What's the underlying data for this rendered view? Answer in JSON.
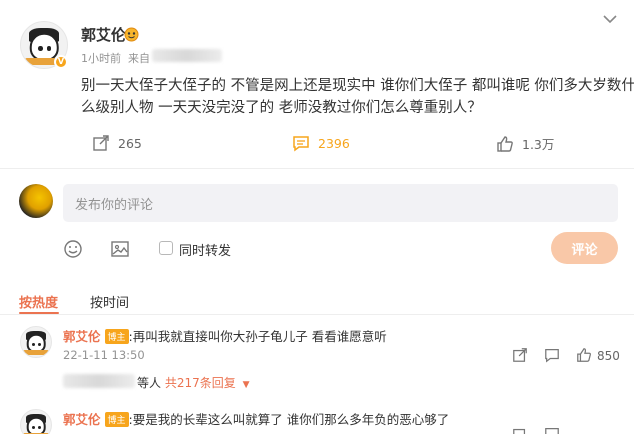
{
  "post": {
    "author_name": "郭艾伦",
    "verified_badge": "V",
    "time": "1小时前",
    "source_prefix": "来自",
    "text_line1": "别一天大侄子大侄子的 不管是网上还是现实中 谁你们大侄子 都叫谁呢 你们多大岁数什",
    "text_line2": "么级别人物 一天天没完没了的 老师没教过你们怎么尊重别人？",
    "actions": {
      "repost_count": "265",
      "comment_count": "2396",
      "like_count": "1.3万"
    }
  },
  "composer": {
    "placeholder": "发布你的评论",
    "also_repost_label": "同时转发",
    "submit_label": "评论"
  },
  "sort_tabs": {
    "hot_label": "按热度",
    "time_label": "按时间"
  },
  "comments": [
    {
      "author": "郭艾伦",
      "tag": "博主",
      "text": ":再叫我就直接叫你大孙子龟儿子 看看谁愿意听",
      "time": "22-1-11 13:50",
      "like_count": "850",
      "reply_suffix": "等人",
      "reply_count_text": "共217条回复"
    },
    {
      "author": "郭艾伦",
      "tag": "博主",
      "text": ":要是我的长辈这么叫就算了 谁你们那么多年负的恶心够了"
    }
  ],
  "colors": {
    "accent": "#eb7350",
    "badge": "#f7a51c",
    "comment_icon": "#f7a51c",
    "submit_disabled": "#f9c8a8"
  }
}
